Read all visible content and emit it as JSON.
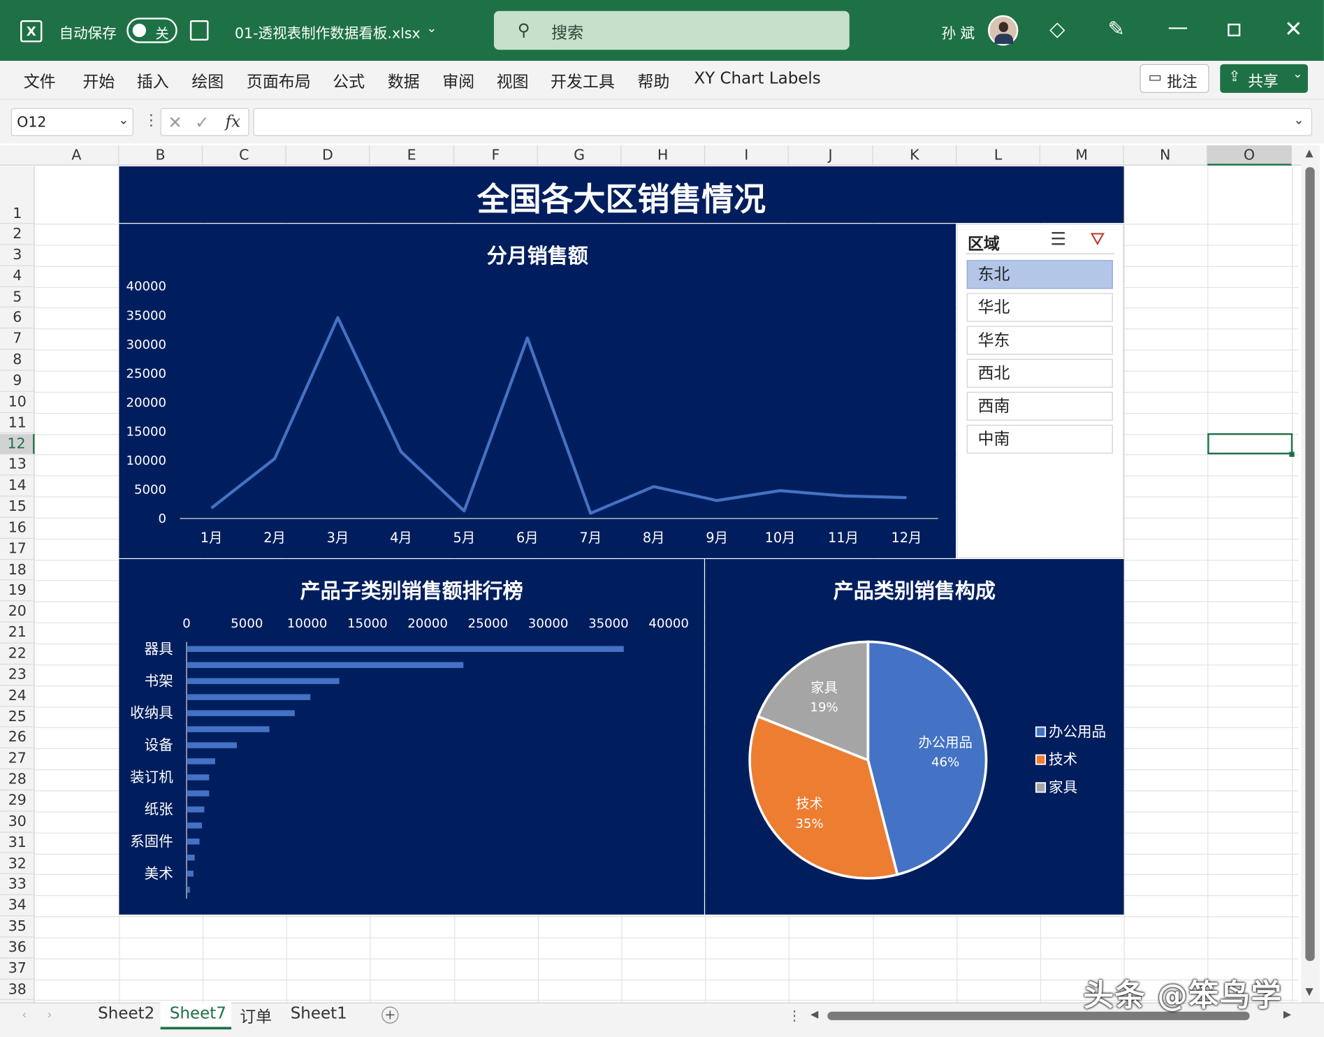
{
  "titlebar": {
    "autosave_label": "自动保存",
    "autosave_state": "关",
    "filename": "01-透视表制作数据看板.xlsx",
    "search_placeholder": "搜索",
    "username": "孙 斌"
  },
  "ribbon": {
    "tabs": [
      "文件",
      "开始",
      "插入",
      "绘图",
      "页面布局",
      "公式",
      "数据",
      "审阅",
      "视图",
      "开发工具",
      "帮助",
      "XY Chart Labels"
    ],
    "comment_label": "批注",
    "share_label": "共享"
  },
  "formula_bar": {
    "name_box": "O12",
    "fx_label": "fx",
    "value": ""
  },
  "columns": [
    "A",
    "B",
    "C",
    "D",
    "E",
    "F",
    "G",
    "H",
    "I",
    "J",
    "K",
    "L",
    "M",
    "N",
    "O"
  ],
  "rows": [
    "1",
    "2",
    "3",
    "4",
    "5",
    "6",
    "7",
    "8",
    "9",
    "10",
    "11",
    "12",
    "13",
    "14",
    "15",
    "16",
    "17",
    "18",
    "19",
    "20",
    "21",
    "22",
    "23",
    "24",
    "25",
    "26",
    "27",
    "28",
    "29",
    "30",
    "31",
    "32",
    "33",
    "34",
    "35",
    "36",
    "37",
    "38"
  ],
  "dashboard": {
    "title": "全国各大区销售情况"
  },
  "slicer": {
    "title": "区域",
    "items": [
      "东北",
      "华北",
      "华东",
      "西北",
      "西南",
      "中南"
    ],
    "selected": "东北",
    "selected_color": "#b4c6e7"
  },
  "chart_data": [
    {
      "type": "line",
      "title": "分月销售额",
      "categories": [
        "1月",
        "2月",
        "3月",
        "4月",
        "5月",
        "6月",
        "7月",
        "8月",
        "9月",
        "10月",
        "11月",
        "12月"
      ],
      "series": [
        {
          "values": [
            1800,
            10300,
            34600,
            11500,
            1300,
            31100,
            900,
            5500,
            3100,
            4800,
            3900,
            3600
          ]
        }
      ],
      "ylim": [
        0,
        40000
      ],
      "yticks": [
        "40000",
        "35000",
        "30000",
        "25000",
        "20000",
        "15000",
        "10000",
        "5000",
        "0"
      ],
      "color": "#4472c4"
    },
    {
      "type": "bar",
      "orientation": "horizontal",
      "title": "产品子类别销售额排行榜",
      "category_labels": [
        "器具",
        "书架",
        "收纳具",
        "设备",
        "装订机",
        "纸张",
        "系固件",
        "美术"
      ],
      "values": [
        36200,
        22900,
        12600,
        10200,
        8900,
        6800,
        4100,
        2300,
        1800,
        1800,
        1400,
        1200,
        1000,
        600,
        500,
        200
      ],
      "xlim": [
        0,
        40000
      ],
      "xticks": [
        "0",
        "5000",
        "10000",
        "15000",
        "20000",
        "25000",
        "30000",
        "35000",
        "40000"
      ],
      "color": "#4472c4"
    },
    {
      "type": "pie",
      "title": "产品类别销售构成",
      "slices": [
        {
          "name": "办公用品",
          "value": 46,
          "label": "46%",
          "color": "#4472c4"
        },
        {
          "name": "技术",
          "value": 35,
          "label": "35%",
          "color": "#ed7d31"
        },
        {
          "name": "家具",
          "value": 19,
          "label": "19%",
          "color": "#a5a5a5"
        }
      ],
      "legend": [
        "办公用品",
        "技术",
        "家具"
      ],
      "legend_position": "right"
    }
  ],
  "sheet_tabs": [
    "Sheet2",
    "Sheet7",
    "订单",
    "Sheet1"
  ],
  "active_sheet": "Sheet7",
  "watermark": "头条 @笨鸟学"
}
